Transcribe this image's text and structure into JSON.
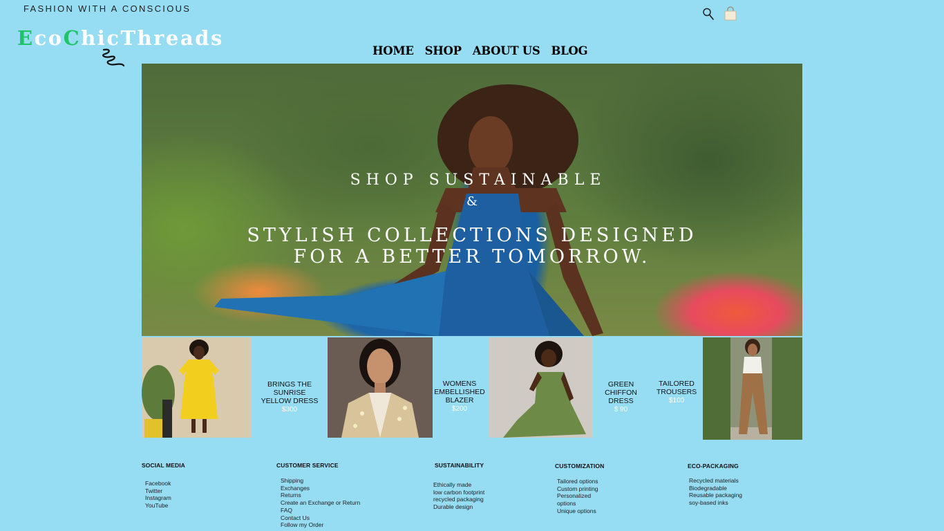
{
  "header": {
    "tagline": "FASHION WITH A CONSCIOUS",
    "logo": {
      "parts": [
        "E",
        "co",
        "C",
        "hic",
        "Threads"
      ],
      "accent_color": "#1ec466"
    },
    "icons": [
      "search-icon",
      "shopping-bag-icon"
    ]
  },
  "nav": [
    "HOME",
    "SHOP",
    "ABOUT US",
    "BLOG"
  ],
  "hero": {
    "line1": "SHOP SUSTAINABLE",
    "amp": "&",
    "line2a": "STYLISH COLLECTIONS DESIGNED",
    "line2b": "FOR A BETTER TOMORROW."
  },
  "products": [
    {
      "name_lines": [
        "BRINGS THE SUNRISE",
        "YELLOW DRESS"
      ],
      "price": "$300"
    },
    {
      "name_lines": [
        "WOMENS",
        "EMBELLISHED",
        "BLAZER"
      ],
      "price": "$200"
    },
    {
      "name_lines": [
        "GREEN CHIFFON",
        "DRESS"
      ],
      "price": "$ 90"
    },
    {
      "name_lines": [
        "TAILORED",
        "TROUSERS"
      ],
      "price": "$100"
    }
  ],
  "footer": [
    {
      "title": "SOCIAL MEDIA",
      "items": [
        "Facebook",
        "Twitter",
        "Instagram",
        "YouTube"
      ]
    },
    {
      "title": "CUSTOMER SERVICE",
      "items": [
        "Shipping",
        "Exchanges",
        "Returns",
        "Create an Exchange or Return",
        "FAQ",
        "Contact Us",
        "Follow my Order"
      ]
    },
    {
      "title": "SUSTAINABILITY",
      "items": [
        "Ethically made",
        "low carbon footprint",
        "recycled packaging",
        "Durable design"
      ]
    },
    {
      "title": "CUSTOMIZATION",
      "items": [
        "Tailored options",
        "Custom printing",
        "Personalized",
        "options",
        "Unique options"
      ]
    },
    {
      "title": "ECO-PACKAGING",
      "items": [
        "Recycled materials",
        "Biodegradable",
        "Reusable packaging",
        "soy-based inks"
      ]
    }
  ]
}
